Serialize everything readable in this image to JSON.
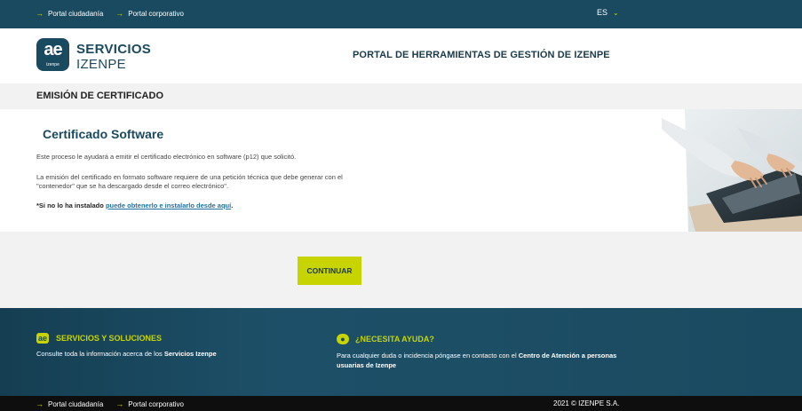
{
  "topbar": {
    "links": [
      "Portal ciudadanía",
      "Portal corporativo"
    ],
    "language": "ES"
  },
  "header": {
    "logo_mark": "ae",
    "logo_sub": "izenpe",
    "brand_line1": "SERVICIOS",
    "brand_line2": "IZENPE",
    "portal_title": "PORTAL DE HERRAMIENTAS DE GESTIÓN DE IZENPE"
  },
  "section": {
    "title": "EMISIÓN DE CERTIFICADO"
  },
  "content": {
    "title": "Certificado Software",
    "paragraph1": "Este proceso le ayudará a emitir el certificado electrónico en software (p12) que solicitó.",
    "paragraph2": "La emisión del certificado en formato software requiere de una petición técnica que debe generar con el \"contenedor\" que se ha descargado desde el correo electrónico\".",
    "paragraph3_prefix": "*Si no lo ha instalado ",
    "paragraph3_link": "puede obtenerlo e instalarlo desde aquí",
    "paragraph3_suffix": "."
  },
  "action": {
    "continue_label": "CONTINUAR"
  },
  "footer": {
    "services_title": "SERVICIOS Y SOLUCIONES",
    "services_text_prefix": "Consulte toda la información acerca de los ",
    "services_text_bold": "Servicios Izenpe",
    "help_title": "¿NECESITA AYUDA?",
    "help_text_prefix": "Para cualquier duda o incidencia póngase en contacto con el ",
    "help_text_bold": "Centro de Atención a personas usuarias de Izenpe"
  },
  "bottombar": {
    "links": [
      "Portal ciudadanía",
      "Portal corporativo"
    ],
    "copyright": "2021 © IZENPE S.A."
  },
  "colors": {
    "brand_dark": "#1a4a60",
    "accent": "#c7d400",
    "link": "#1f6fa0"
  }
}
